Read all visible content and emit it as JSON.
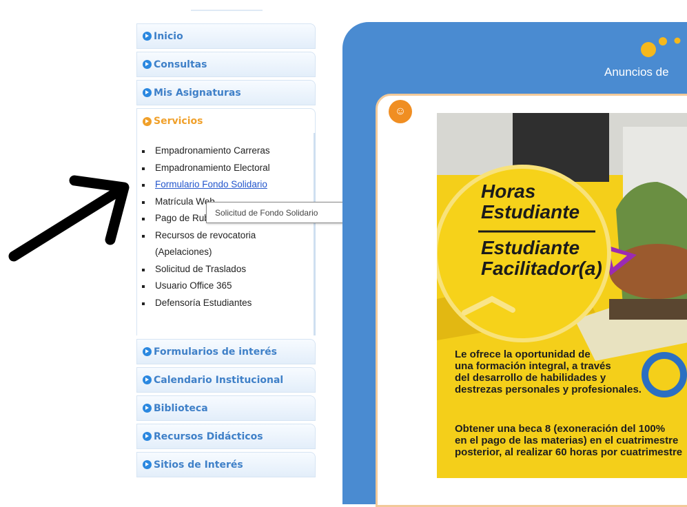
{
  "sidebar": {
    "items": [
      {
        "label": "Inicio"
      },
      {
        "label": "Consultas"
      },
      {
        "label": "Mis Asignaturas"
      },
      {
        "label": "Servicios"
      },
      {
        "label": "Formularios de interés"
      },
      {
        "label": "Calendario Institucional"
      },
      {
        "label": "Biblioteca"
      },
      {
        "label": "Recursos Didácticos"
      },
      {
        "label": "Sitios de Interés"
      }
    ],
    "services_submenu": [
      "Empadronamiento Carreras",
      "Empadronamiento Electoral",
      "Formulario Fondo Solidario",
      "Matrícula Web",
      "Pago de Rubros",
      "Recursos de revocatoria",
      "(Apelaciones)",
      "Solicitud de Traslados",
      "Usuario Office 365",
      "Defensoría Estudiantes"
    ]
  },
  "tooltip": "Solicitud de Fondo Solidario",
  "panel": {
    "title": "Anuncios de",
    "poster": {
      "heading_line1": "Horas",
      "heading_line2": "Estudiante",
      "heading_line3": "Estudiante",
      "heading_line4": "Facilitador(a)",
      "body_lines": [
        "Le ofrece la oportunidad de",
        "una formación integral, a través",
        "del desarrollo de habilidades y",
        "destrezas personales y profesionales."
      ],
      "body2_lines": [
        "Obtener una beca 8 (exoneración del 100%",
        "en el pago de las materias) en el cuatrimestre",
        "posterior, al realizar 60 horas por cuatrimestre"
      ]
    }
  },
  "colors": {
    "nav_text": "#3f80c8",
    "nav_active": "#f0a02a",
    "panel_blue": "#4a8bd1",
    "poster_yellow": "#f4cf1a",
    "link": "#2255cc"
  }
}
